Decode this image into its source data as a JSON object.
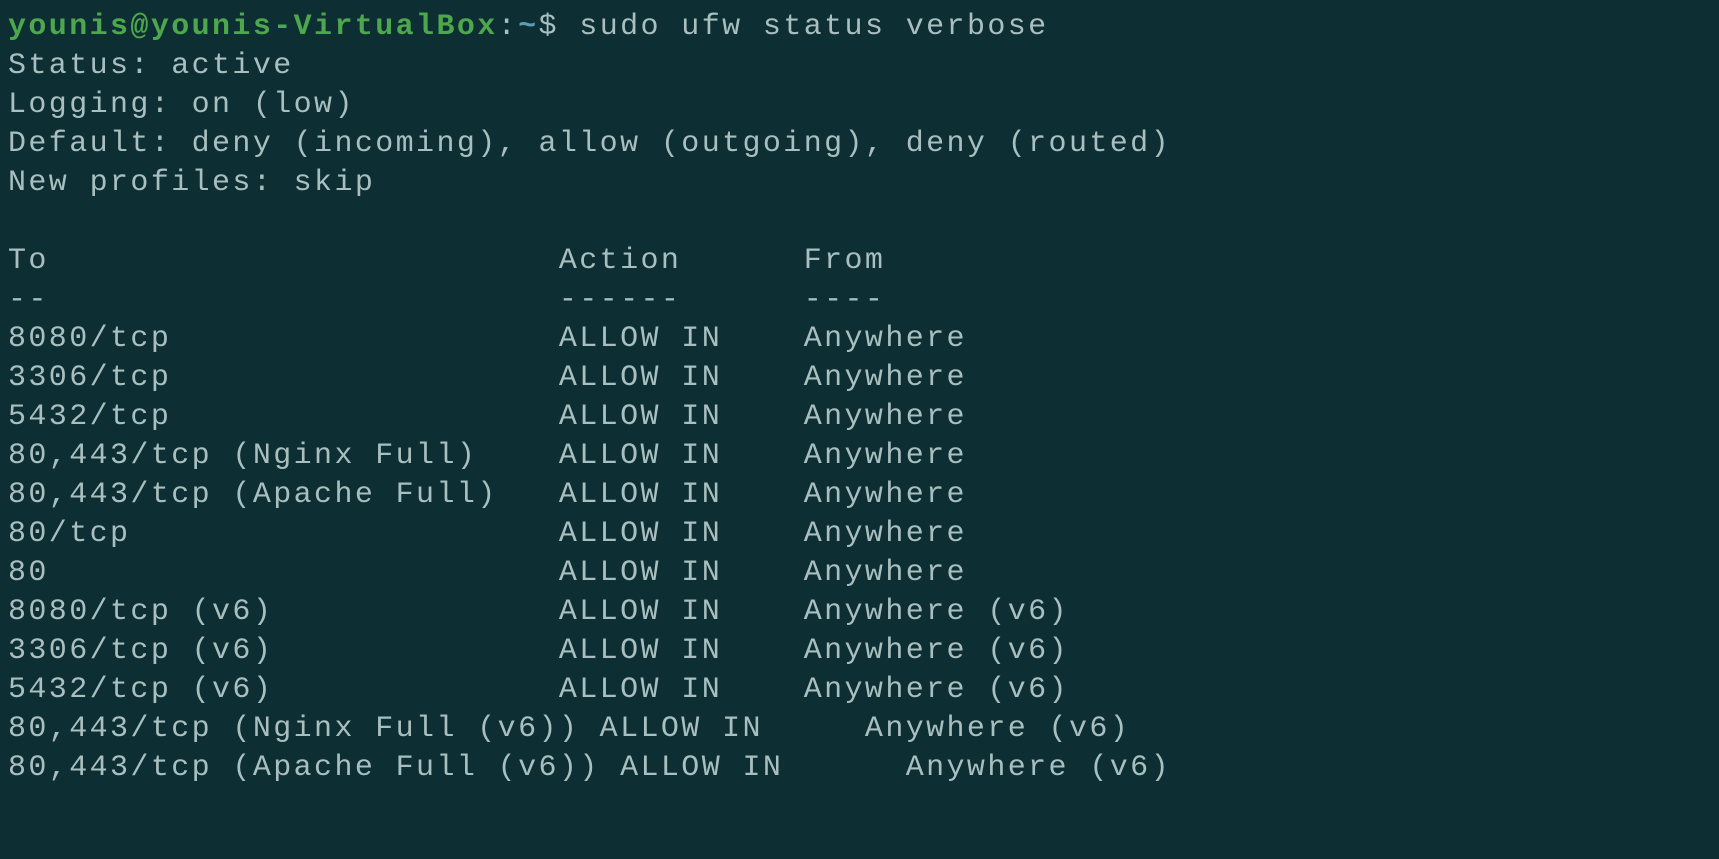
{
  "prompt": {
    "user": "younis@younis-VirtualBox",
    "separator": ":",
    "path": "~",
    "symbol": "$",
    "command": "sudo ufw status verbose"
  },
  "status": {
    "status_line": "Status: active",
    "logging_line": "Logging: on (low)",
    "default_line": "Default: deny (incoming), allow (outgoing), deny (routed)",
    "profiles_line": "New profiles: skip"
  },
  "table": {
    "header": {
      "to": "To",
      "action": "Action",
      "from": "From"
    },
    "divider": {
      "to": "--",
      "action": "------",
      "from": "----"
    },
    "rows": [
      {
        "to": "8080/tcp",
        "action": "ALLOW IN",
        "from": "Anywhere"
      },
      {
        "to": "3306/tcp",
        "action": "ALLOW IN",
        "from": "Anywhere"
      },
      {
        "to": "5432/tcp",
        "action": "ALLOW IN",
        "from": "Anywhere"
      },
      {
        "to": "80,443/tcp (Nginx Full)",
        "action": "ALLOW IN",
        "from": "Anywhere"
      },
      {
        "to": "80,443/tcp (Apache Full)",
        "action": "ALLOW IN",
        "from": "Anywhere"
      },
      {
        "to": "80/tcp",
        "action": "ALLOW IN",
        "from": "Anywhere"
      },
      {
        "to": "80",
        "action": "ALLOW IN",
        "from": "Anywhere"
      },
      {
        "to": "8080/tcp (v6)",
        "action": "ALLOW IN",
        "from": "Anywhere (v6)"
      },
      {
        "to": "3306/tcp (v6)",
        "action": "ALLOW IN",
        "from": "Anywhere (v6)"
      },
      {
        "to": "5432/tcp (v6)",
        "action": "ALLOW IN",
        "from": "Anywhere (v6)"
      },
      {
        "to": "80,443/tcp (Nginx Full (v6))",
        "action": "ALLOW IN",
        "from": " Anywhere (v6)"
      },
      {
        "to": "80,443/tcp (Apache Full (v6))",
        "action": "ALLOW IN",
        "from": "  Anywhere (v6)"
      }
    ]
  }
}
